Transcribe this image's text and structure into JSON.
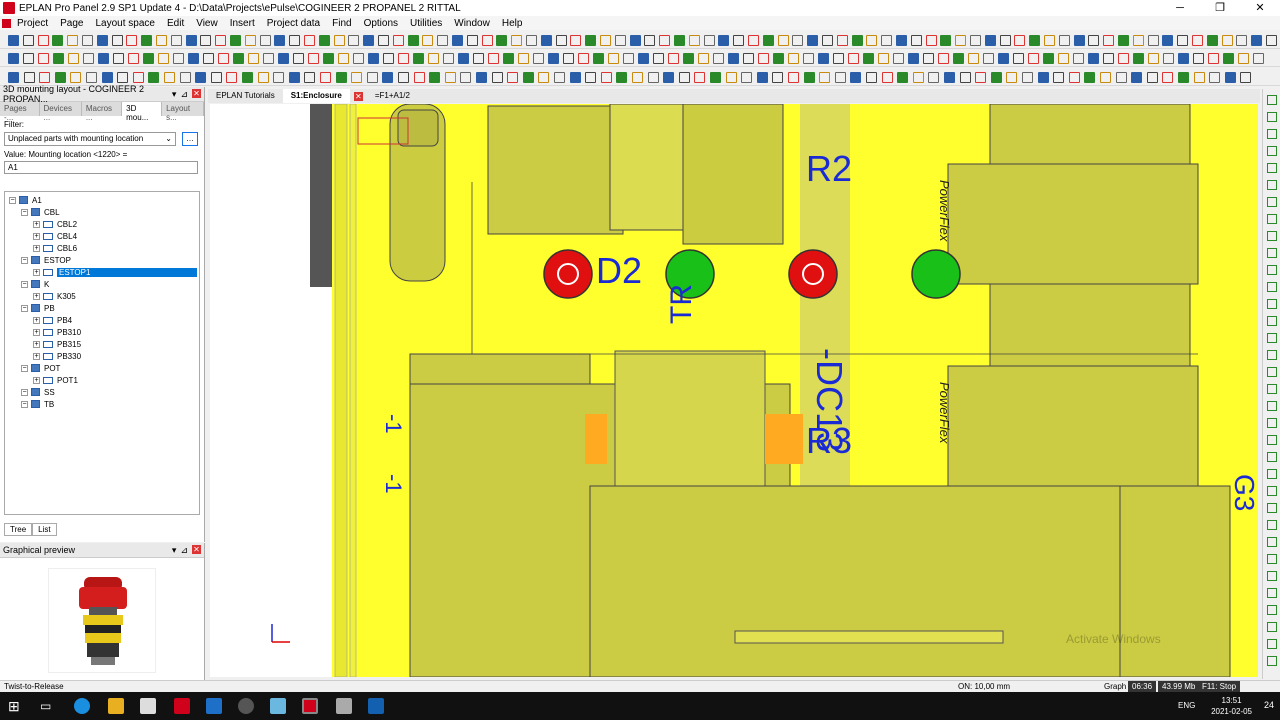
{
  "window": {
    "title": "EPLAN Pro Panel 2.9 SP1 Update 4 - D:\\Data\\Projects\\ePulse\\COGINEER 2 PROPANEL 2 RITTAL"
  },
  "menu": [
    "Project",
    "Page",
    "Layout space",
    "Edit",
    "View",
    "Insert",
    "Project data",
    "Find",
    "Options",
    "Utilities",
    "Window",
    "Help"
  ],
  "layout_panel": {
    "title": "3D mounting layout - COGINEER 2 PROPAN...",
    "tabs": [
      "Pages -...",
      "Devices ...",
      "Macros ...",
      "3D mou...",
      "Layout s..."
    ],
    "filter_label": "Filter:",
    "filter_value": "Unplaced parts with mounting location",
    "value_label": "Value: Mounting location <1220> =",
    "value_input": "A1",
    "tree": [
      {
        "label": "A1",
        "level": 0
      },
      {
        "label": "CBL",
        "level": 1
      },
      {
        "label": "CBL2",
        "level": 2
      },
      {
        "label": "CBL4",
        "level": 2
      },
      {
        "label": "CBL6",
        "level": 2
      },
      {
        "label": "ESTOP",
        "level": 1
      },
      {
        "label": "ESTOP1",
        "level": 2,
        "selected": true
      },
      {
        "label": "K",
        "level": 1
      },
      {
        "label": "K305",
        "level": 2
      },
      {
        "label": "PB",
        "level": 1
      },
      {
        "label": "PB4",
        "level": 2
      },
      {
        "label": "PB310",
        "level": 2
      },
      {
        "label": "PB315",
        "level": 2
      },
      {
        "label": "PB330",
        "level": 2
      },
      {
        "label": "POT",
        "level": 1
      },
      {
        "label": "POT1",
        "level": 2
      },
      {
        "label": "SS",
        "level": 1
      },
      {
        "label": "TB",
        "level": 1
      }
    ],
    "bottom_tabs": [
      "Tree",
      "List"
    ]
  },
  "preview_panel": {
    "title": "Graphical preview"
  },
  "doc_tabs": [
    "EPLAN Tutorials",
    "S1:Enclosure",
    "=F1+A1/2"
  ],
  "drawing_labels": {
    "r2": "R2",
    "d2": "D2",
    "tr": "TR",
    "dc13": "-DC13",
    "r3": "R3",
    "l1": "-1",
    "l2": "-1",
    "g3": "G3",
    "powerflex": "PowerFlex"
  },
  "status": {
    "hint": "Twist-to-Release",
    "on_value": "ON: 10,00 mm",
    "graph": "Graph",
    "time_elapsed": "06:36",
    "memory": "43.99 Mb",
    "f11": "F11: Stop"
  },
  "taskbar": {
    "lang": "ENG",
    "time": "13:51",
    "date": "2021-02-05",
    "notif": "24"
  },
  "watermark": {
    "line1": "Activate Windows"
  },
  "colors": {
    "panel_yellow": "#ffff33",
    "device_fill": "#cccc44",
    "label_blue": "#1a2bd6",
    "button_red": "#e01010",
    "button_green": "#18c018",
    "selected": "#0078d7"
  }
}
